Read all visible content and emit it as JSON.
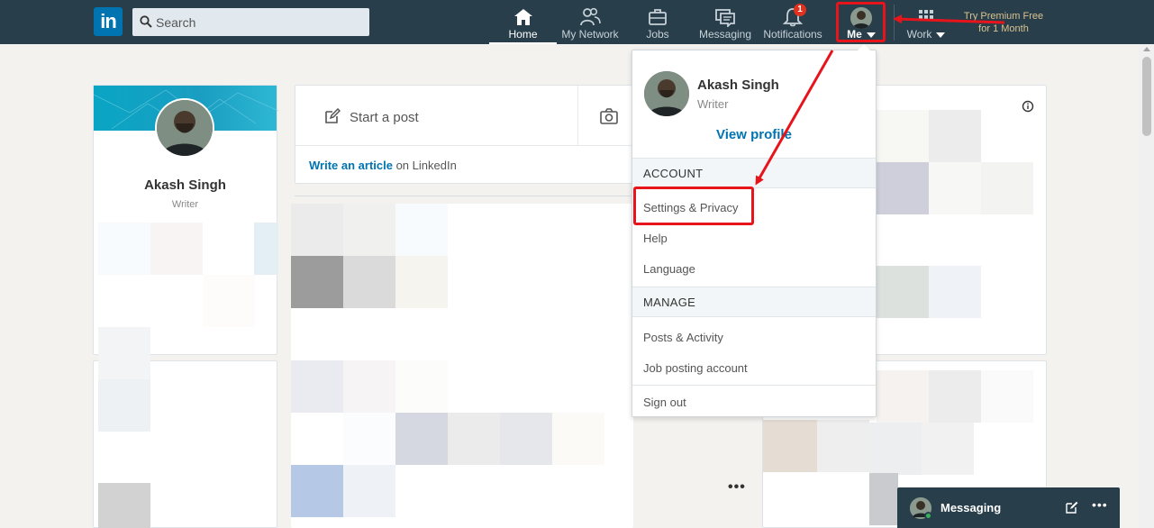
{
  "nav": {
    "logo_text": "in",
    "search_placeholder": "Search",
    "items": [
      {
        "label": "Home"
      },
      {
        "label": "My Network"
      },
      {
        "label": "Jobs"
      },
      {
        "label": "Messaging"
      },
      {
        "label": "Notifications",
        "badge": "1"
      }
    ],
    "me_label": "Me",
    "work_label": "Work",
    "premium_line1": "Try Premium Free",
    "premium_line2": "for 1 Month"
  },
  "profile": {
    "name": "Akash Singh",
    "title": "Writer"
  },
  "share": {
    "start_post": "Start a post",
    "write_article_link": "Write an article",
    "write_article_rest": " on LinkedIn"
  },
  "me_menu": {
    "name": "Akash Singh",
    "title": "Writer",
    "view_profile": "View profile",
    "account_header": "ACCOUNT",
    "account_items": [
      "Settings & Privacy",
      "Help",
      "Language"
    ],
    "manage_header": "MANAGE",
    "manage_items": [
      "Posts & Activity",
      "Job posting account"
    ],
    "sign_out": "Sign out"
  },
  "messaging_bar": {
    "title": "Messaging"
  },
  "colors": {
    "nav_bg": "#283e4a",
    "brand_blue": "#0073b1",
    "highlight_red": "#e8141b",
    "badge_red": "#e0301e"
  }
}
